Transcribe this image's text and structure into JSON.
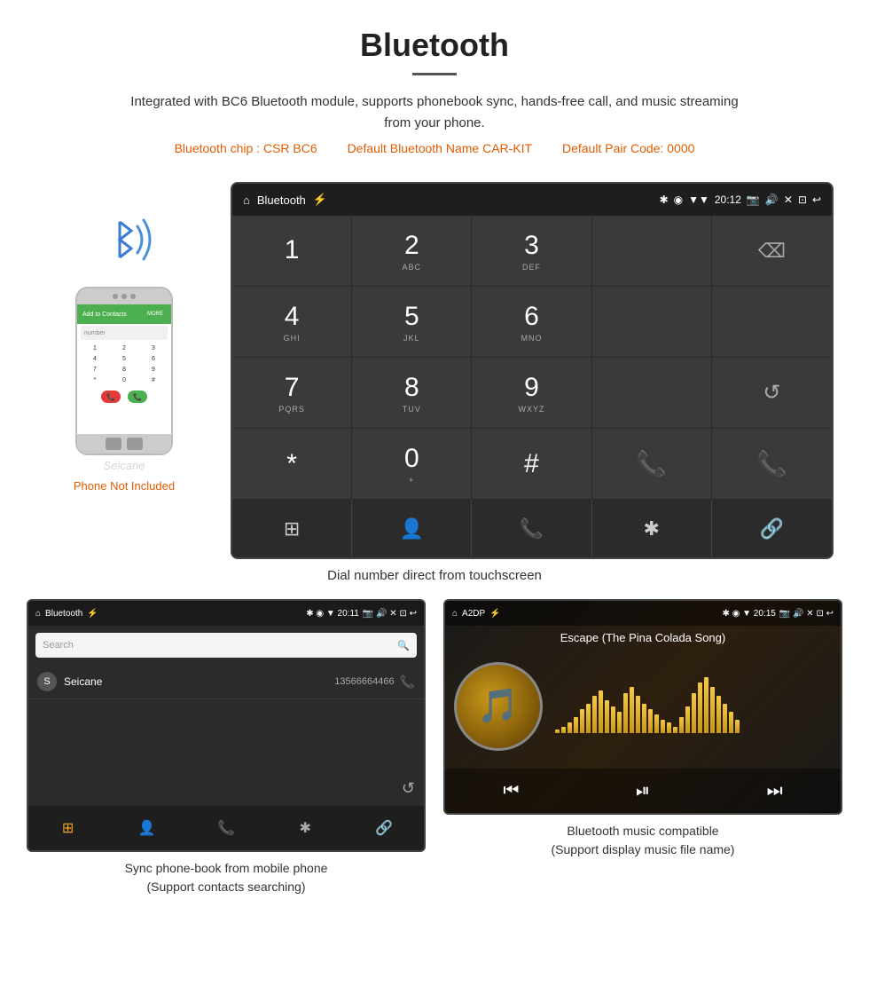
{
  "header": {
    "title": "Bluetooth",
    "description": "Integrated with BC6 Bluetooth module, supports phonebook sync, hands-free call, and music streaming from your phone.",
    "specs": {
      "chip": "Bluetooth chip : CSR BC6",
      "name": "Default Bluetooth Name CAR-KIT",
      "code": "Default Pair Code: 0000"
    }
  },
  "phone_aside": {
    "not_included": "Phone Not Included"
  },
  "dial_screen": {
    "status_bar": {
      "home_icon": "⌂",
      "title": "Bluetooth",
      "usb_icon": "⚡",
      "bluetooth_icon": "✱",
      "location_icon": "◉",
      "signal_icon": "▼",
      "time": "20:12",
      "camera_icon": "📷",
      "volume_icon": "🔊",
      "close_icon": "✕",
      "window_icon": "⊡",
      "back_icon": "↩"
    },
    "keypad": [
      {
        "num": "1",
        "sub": ""
      },
      {
        "num": "2",
        "sub": "ABC"
      },
      {
        "num": "3",
        "sub": "DEF"
      },
      {
        "num": "",
        "sub": ""
      },
      {
        "num": "⌫",
        "sub": ""
      }
    ],
    "keypad2": [
      {
        "num": "4",
        "sub": "GHI"
      },
      {
        "num": "5",
        "sub": "JKL"
      },
      {
        "num": "6",
        "sub": "MNO"
      },
      {
        "num": "",
        "sub": ""
      },
      {
        "num": "",
        "sub": ""
      }
    ],
    "keypad3": [
      {
        "num": "7",
        "sub": "PQRS"
      },
      {
        "num": "8",
        "sub": "TUV"
      },
      {
        "num": "9",
        "sub": "WXYZ"
      },
      {
        "num": "",
        "sub": ""
      },
      {
        "num": "↺",
        "sub": ""
      }
    ],
    "keypad4": [
      {
        "num": "*",
        "sub": ""
      },
      {
        "num": "0",
        "sub": "+"
      },
      {
        "num": "#",
        "sub": ""
      },
      {
        "num": "📞",
        "sub": ""
      },
      {
        "num": "📞",
        "sub": ""
      }
    ],
    "toolbar": [
      "⊞",
      "👤",
      "📞",
      "✱",
      "🔗"
    ],
    "caption": "Dial number direct from touchscreen"
  },
  "phonebook_screen": {
    "status": {
      "home": "⌂",
      "title": "Bluetooth",
      "usb": "⚡",
      "icons_right": "✱ ◉ ▼ 20:11 📷 🔊 ✕ ⊡ ↩"
    },
    "search_placeholder": "Search",
    "contact": {
      "avatar": "S",
      "name": "Seicane",
      "number": "13566664466"
    },
    "toolbar": [
      "⊞",
      "👤",
      "📞",
      "✱",
      "🔗"
    ],
    "caption_line1": "Sync phone-book from mobile phone",
    "caption_line2": "(Support contacts searching)"
  },
  "music_screen": {
    "status": {
      "home": "⌂",
      "title": "A2DP",
      "usb": "⚡",
      "icons_right": "✱ ◉ ▼ 20:15 📷 🔊 ✕ ⊡ ↩"
    },
    "song_title": "Escape (The Pina Colada Song)",
    "music_icon": "🎵",
    "controls": [
      "⏮",
      "⏯",
      "⏭"
    ],
    "caption_line1": "Bluetooth music compatible",
    "caption_line2": "(Support display music file name)"
  },
  "viz_bars": [
    3,
    5,
    8,
    12,
    18,
    22,
    28,
    32,
    25,
    20,
    16,
    30,
    35,
    28,
    22,
    18,
    14,
    10,
    8,
    5,
    12,
    20,
    30,
    38,
    42,
    35,
    28,
    22,
    16,
    10
  ]
}
